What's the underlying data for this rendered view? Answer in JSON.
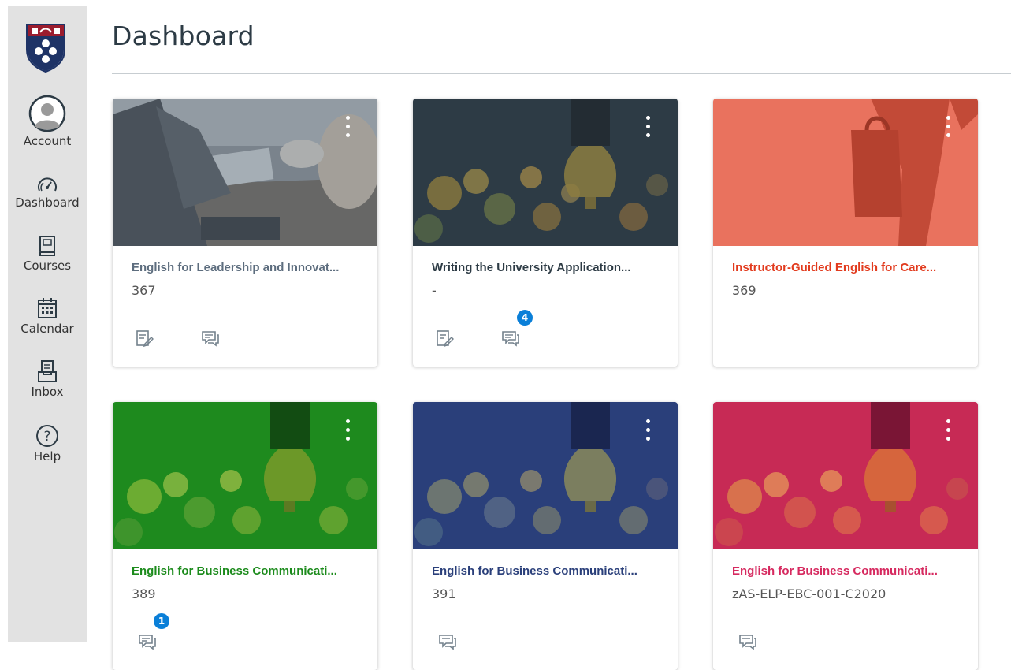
{
  "page": {
    "title": "Dashboard"
  },
  "sidebar": {
    "items": [
      {
        "label": "Account",
        "icon": "account-avatar-icon"
      },
      {
        "label": "Dashboard",
        "icon": "speedometer-icon"
      },
      {
        "label": "Courses",
        "icon": "book-icon"
      },
      {
        "label": "Calendar",
        "icon": "calendar-icon"
      },
      {
        "label": "Inbox",
        "icon": "inbox-icon"
      },
      {
        "label": "Help",
        "icon": "help-question-icon"
      }
    ]
  },
  "courses": [
    {
      "title": "English for Leadership and Innovat...",
      "subtitle": "367",
      "color": "#5d6d7e",
      "hero": "office-laptops",
      "badge": ""
    },
    {
      "title": "Writing the University Application...",
      "subtitle": "-",
      "color": "#2d3b45",
      "hero": "lightbulb-bokeh",
      "badge": "4"
    },
    {
      "title": "Instructor-Guided English for Care...",
      "subtitle": "369",
      "color": "#e23b1e",
      "hero": "briefcase-walker",
      "badge": ""
    },
    {
      "title": "English for Business Communicati...",
      "subtitle": "389",
      "color": "#1c8b1c",
      "hero": "lightbulb-bokeh",
      "badge": "1"
    },
    {
      "title": "English for Business Communicati...",
      "subtitle": "391",
      "color": "#2a3f7a",
      "hero": "lightbulb-bokeh",
      "badge": ""
    },
    {
      "title": "English for Business Communicati...",
      "subtitle": "zAS-ELP-EBC-001-C2020",
      "color": "#d6295f",
      "hero": "lightbulb-bokeh",
      "badge": ""
    }
  ],
  "colors": {
    "sidebar_bg": "#e2e2e2",
    "badge": "#0a7fd8",
    "rule": "#c7cdd1"
  }
}
